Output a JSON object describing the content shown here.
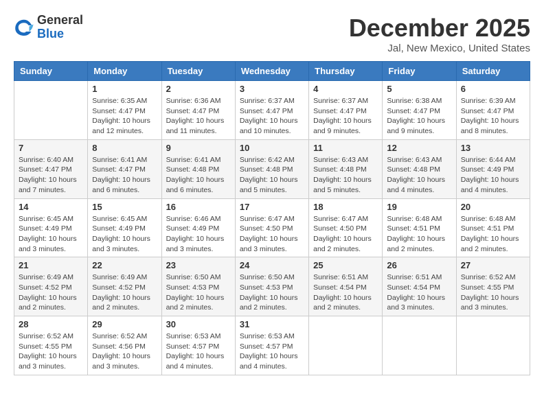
{
  "header": {
    "logo": {
      "general": "General",
      "blue": "Blue"
    },
    "title": "December 2025",
    "location": "Jal, New Mexico, United States"
  },
  "days_of_week": [
    "Sunday",
    "Monday",
    "Tuesday",
    "Wednesday",
    "Thursday",
    "Friday",
    "Saturday"
  ],
  "weeks": [
    [
      {
        "day": "",
        "sunrise": "",
        "sunset": "",
        "daylight": ""
      },
      {
        "day": "1",
        "sunrise": "Sunrise: 6:35 AM",
        "sunset": "Sunset: 4:47 PM",
        "daylight": "Daylight: 10 hours and 12 minutes."
      },
      {
        "day": "2",
        "sunrise": "Sunrise: 6:36 AM",
        "sunset": "Sunset: 4:47 PM",
        "daylight": "Daylight: 10 hours and 11 minutes."
      },
      {
        "day": "3",
        "sunrise": "Sunrise: 6:37 AM",
        "sunset": "Sunset: 4:47 PM",
        "daylight": "Daylight: 10 hours and 10 minutes."
      },
      {
        "day": "4",
        "sunrise": "Sunrise: 6:37 AM",
        "sunset": "Sunset: 4:47 PM",
        "daylight": "Daylight: 10 hours and 9 minutes."
      },
      {
        "day": "5",
        "sunrise": "Sunrise: 6:38 AM",
        "sunset": "Sunset: 4:47 PM",
        "daylight": "Daylight: 10 hours and 9 minutes."
      },
      {
        "day": "6",
        "sunrise": "Sunrise: 6:39 AM",
        "sunset": "Sunset: 4:47 PM",
        "daylight": "Daylight: 10 hours and 8 minutes."
      }
    ],
    [
      {
        "day": "7",
        "sunrise": "Sunrise: 6:40 AM",
        "sunset": "Sunset: 4:47 PM",
        "daylight": "Daylight: 10 hours and 7 minutes."
      },
      {
        "day": "8",
        "sunrise": "Sunrise: 6:41 AM",
        "sunset": "Sunset: 4:47 PM",
        "daylight": "Daylight: 10 hours and 6 minutes."
      },
      {
        "day": "9",
        "sunrise": "Sunrise: 6:41 AM",
        "sunset": "Sunset: 4:48 PM",
        "daylight": "Daylight: 10 hours and 6 minutes."
      },
      {
        "day": "10",
        "sunrise": "Sunrise: 6:42 AM",
        "sunset": "Sunset: 4:48 PM",
        "daylight": "Daylight: 10 hours and 5 minutes."
      },
      {
        "day": "11",
        "sunrise": "Sunrise: 6:43 AM",
        "sunset": "Sunset: 4:48 PM",
        "daylight": "Daylight: 10 hours and 5 minutes."
      },
      {
        "day": "12",
        "sunrise": "Sunrise: 6:43 AM",
        "sunset": "Sunset: 4:48 PM",
        "daylight": "Daylight: 10 hours and 4 minutes."
      },
      {
        "day": "13",
        "sunrise": "Sunrise: 6:44 AM",
        "sunset": "Sunset: 4:49 PM",
        "daylight": "Daylight: 10 hours and 4 minutes."
      }
    ],
    [
      {
        "day": "14",
        "sunrise": "Sunrise: 6:45 AM",
        "sunset": "Sunset: 4:49 PM",
        "daylight": "Daylight: 10 hours and 3 minutes."
      },
      {
        "day": "15",
        "sunrise": "Sunrise: 6:45 AM",
        "sunset": "Sunset: 4:49 PM",
        "daylight": "Daylight: 10 hours and 3 minutes."
      },
      {
        "day": "16",
        "sunrise": "Sunrise: 6:46 AM",
        "sunset": "Sunset: 4:49 PM",
        "daylight": "Daylight: 10 hours and 3 minutes."
      },
      {
        "day": "17",
        "sunrise": "Sunrise: 6:47 AM",
        "sunset": "Sunset: 4:50 PM",
        "daylight": "Daylight: 10 hours and 3 minutes."
      },
      {
        "day": "18",
        "sunrise": "Sunrise: 6:47 AM",
        "sunset": "Sunset: 4:50 PM",
        "daylight": "Daylight: 10 hours and 2 minutes."
      },
      {
        "day": "19",
        "sunrise": "Sunrise: 6:48 AM",
        "sunset": "Sunset: 4:51 PM",
        "daylight": "Daylight: 10 hours and 2 minutes."
      },
      {
        "day": "20",
        "sunrise": "Sunrise: 6:48 AM",
        "sunset": "Sunset: 4:51 PM",
        "daylight": "Daylight: 10 hours and 2 minutes."
      }
    ],
    [
      {
        "day": "21",
        "sunrise": "Sunrise: 6:49 AM",
        "sunset": "Sunset: 4:52 PM",
        "daylight": "Daylight: 10 hours and 2 minutes."
      },
      {
        "day": "22",
        "sunrise": "Sunrise: 6:49 AM",
        "sunset": "Sunset: 4:52 PM",
        "daylight": "Daylight: 10 hours and 2 minutes."
      },
      {
        "day": "23",
        "sunrise": "Sunrise: 6:50 AM",
        "sunset": "Sunset: 4:53 PM",
        "daylight": "Daylight: 10 hours and 2 minutes."
      },
      {
        "day": "24",
        "sunrise": "Sunrise: 6:50 AM",
        "sunset": "Sunset: 4:53 PM",
        "daylight": "Daylight: 10 hours and 2 minutes."
      },
      {
        "day": "25",
        "sunrise": "Sunrise: 6:51 AM",
        "sunset": "Sunset: 4:54 PM",
        "daylight": "Daylight: 10 hours and 2 minutes."
      },
      {
        "day": "26",
        "sunrise": "Sunrise: 6:51 AM",
        "sunset": "Sunset: 4:54 PM",
        "daylight": "Daylight: 10 hours and 3 minutes."
      },
      {
        "day": "27",
        "sunrise": "Sunrise: 6:52 AM",
        "sunset": "Sunset: 4:55 PM",
        "daylight": "Daylight: 10 hours and 3 minutes."
      }
    ],
    [
      {
        "day": "28",
        "sunrise": "Sunrise: 6:52 AM",
        "sunset": "Sunset: 4:55 PM",
        "daylight": "Daylight: 10 hours and 3 minutes."
      },
      {
        "day": "29",
        "sunrise": "Sunrise: 6:52 AM",
        "sunset": "Sunset: 4:56 PM",
        "daylight": "Daylight: 10 hours and 3 minutes."
      },
      {
        "day": "30",
        "sunrise": "Sunrise: 6:53 AM",
        "sunset": "Sunset: 4:57 PM",
        "daylight": "Daylight: 10 hours and 4 minutes."
      },
      {
        "day": "31",
        "sunrise": "Sunrise: 6:53 AM",
        "sunset": "Sunset: 4:57 PM",
        "daylight": "Daylight: 10 hours and 4 minutes."
      },
      {
        "day": "",
        "sunrise": "",
        "sunset": "",
        "daylight": ""
      },
      {
        "day": "",
        "sunrise": "",
        "sunset": "",
        "daylight": ""
      },
      {
        "day": "",
        "sunrise": "",
        "sunset": "",
        "daylight": ""
      }
    ]
  ]
}
